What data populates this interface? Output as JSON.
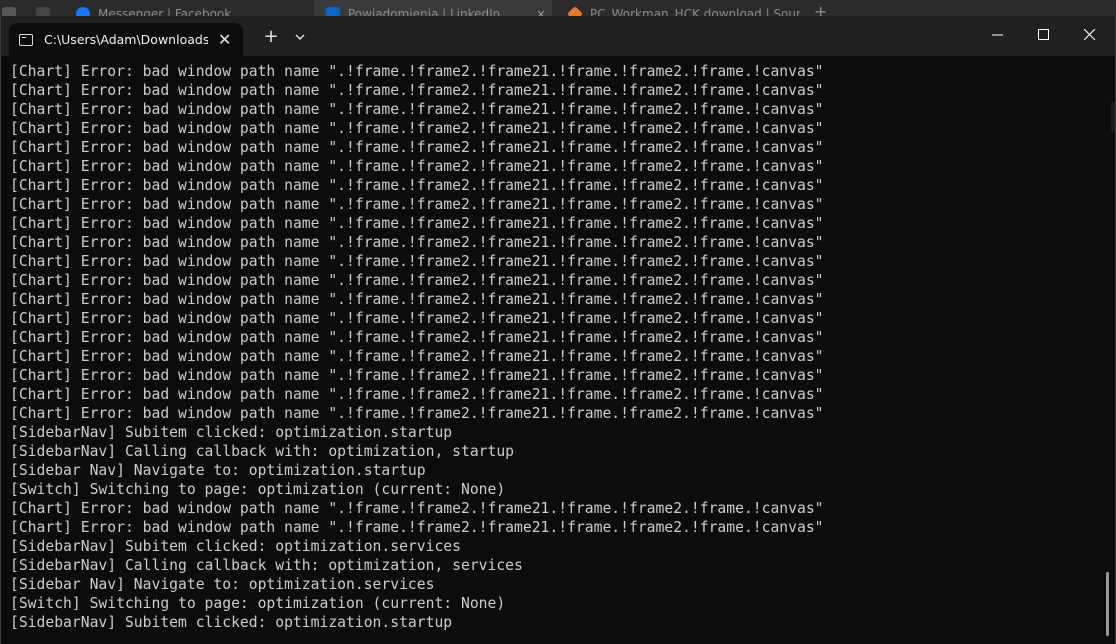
{
  "browser_tabs": [
    {
      "label": "Messenger | Facebook",
      "favicon_color": "#1877f2"
    },
    {
      "label": "Powiadomienia | LinkedIn",
      "favicon_color": "#0a66c2"
    },
    {
      "label": "PC_Workman_HCK download | Sour",
      "favicon_color": "#e8792c"
    }
  ],
  "terminal": {
    "tab_title": "C:\\Users\\Adam\\Downloads\\PC",
    "tab_icon": "console-icon",
    "new_tab_icon": "plus-icon",
    "dropdown_icon": "chevron-down-icon",
    "controls": {
      "minimize_icon": "minimize-icon",
      "maximize_icon": "maximize-icon",
      "close_icon": "close-icon"
    }
  },
  "console_lines": [
    "[Chart] Error: bad window path name \".!frame.!frame2.!frame21.!frame.!frame2.!frame.!canvas\"",
    "[Chart] Error: bad window path name \".!frame.!frame2.!frame21.!frame.!frame2.!frame.!canvas\"",
    "[Chart] Error: bad window path name \".!frame.!frame2.!frame21.!frame.!frame2.!frame.!canvas\"",
    "[Chart] Error: bad window path name \".!frame.!frame2.!frame21.!frame.!frame2.!frame.!canvas\"",
    "[Chart] Error: bad window path name \".!frame.!frame2.!frame21.!frame.!frame2.!frame.!canvas\"",
    "[Chart] Error: bad window path name \".!frame.!frame2.!frame21.!frame.!frame2.!frame.!canvas\"",
    "[Chart] Error: bad window path name \".!frame.!frame2.!frame21.!frame.!frame2.!frame.!canvas\"",
    "[Chart] Error: bad window path name \".!frame.!frame2.!frame21.!frame.!frame2.!frame.!canvas\"",
    "[Chart] Error: bad window path name \".!frame.!frame2.!frame21.!frame.!frame2.!frame.!canvas\"",
    "[Chart] Error: bad window path name \".!frame.!frame2.!frame21.!frame.!frame2.!frame.!canvas\"",
    "[Chart] Error: bad window path name \".!frame.!frame2.!frame21.!frame.!frame2.!frame.!canvas\"",
    "[Chart] Error: bad window path name \".!frame.!frame2.!frame21.!frame.!frame2.!frame.!canvas\"",
    "[Chart] Error: bad window path name \".!frame.!frame2.!frame21.!frame.!frame2.!frame.!canvas\"",
    "[Chart] Error: bad window path name \".!frame.!frame2.!frame21.!frame.!frame2.!frame.!canvas\"",
    "[Chart] Error: bad window path name \".!frame.!frame2.!frame21.!frame.!frame2.!frame.!canvas\"",
    "[Chart] Error: bad window path name \".!frame.!frame2.!frame21.!frame.!frame2.!frame.!canvas\"",
    "[Chart] Error: bad window path name \".!frame.!frame2.!frame21.!frame.!frame2.!frame.!canvas\"",
    "[Chart] Error: bad window path name \".!frame.!frame2.!frame21.!frame.!frame2.!frame.!canvas\"",
    "[Chart] Error: bad window path name \".!frame.!frame2.!frame21.!frame.!frame2.!frame.!canvas\"",
    "[SidebarNav] Subitem clicked: optimization.startup",
    "[SidebarNav] Calling callback with: optimization, startup",
    "[Sidebar Nav] Navigate to: optimization.startup",
    "[Switch] Switching to page: optimization (current: None)",
    "[Chart] Error: bad window path name \".!frame.!frame2.!frame21.!frame.!frame2.!frame.!canvas\"",
    "[Chart] Error: bad window path name \".!frame.!frame2.!frame21.!frame.!frame2.!frame.!canvas\"",
    "[SidebarNav] Subitem clicked: optimization.services",
    "[SidebarNav] Calling callback with: optimization, services",
    "[Sidebar Nav] Navigate to: optimization.services",
    "[Switch] Switching to page: optimization (current: None)",
    "[SidebarNav] Subitem clicked: optimization.startup"
  ]
}
